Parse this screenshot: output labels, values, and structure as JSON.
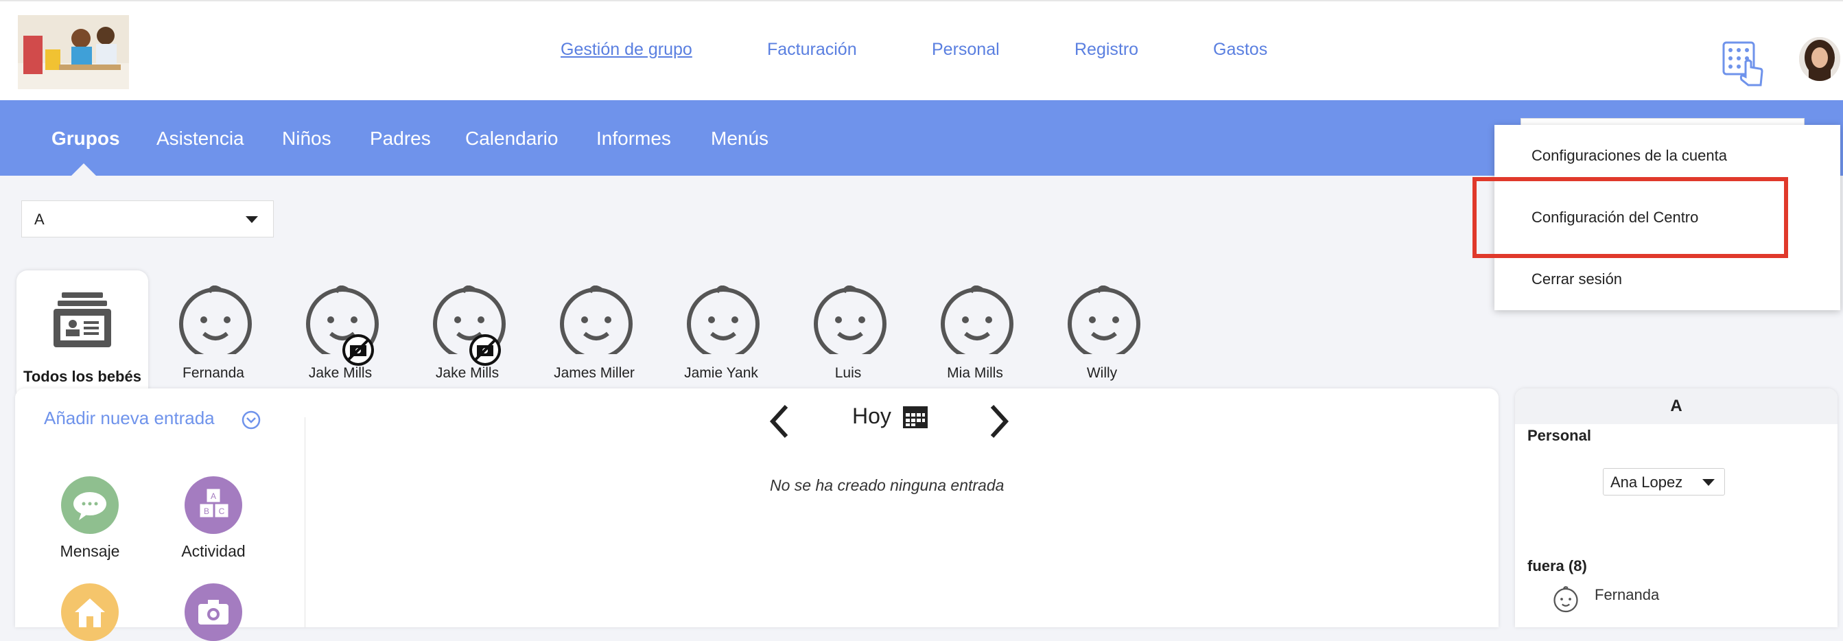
{
  "top_nav": {
    "items": [
      "Gestión de grupo",
      "Facturación",
      "Personal",
      "Registro",
      "Gastos"
    ],
    "active": "Gestión de grupo",
    "link_color": "#5a7fe0"
  },
  "main_tabs": {
    "items": [
      "Grupos",
      "Asistencia",
      "Niños",
      "Padres",
      "Calendario",
      "Informes",
      "Menús"
    ],
    "active": "Grupos",
    "bar_color": "#6f93eb"
  },
  "group_selector": {
    "value": "A"
  },
  "children": {
    "all_label": "Todos los bebés",
    "list": [
      {
        "name": "Fernanda",
        "no_photo_permission": false
      },
      {
        "name": "Jake Mills",
        "no_photo_permission": true
      },
      {
        "name": "Jake Mills",
        "no_photo_permission": true
      },
      {
        "name": "James Miller",
        "no_photo_permission": false
      },
      {
        "name": "Jamie Yank",
        "no_photo_permission": false
      },
      {
        "name": "Luis",
        "no_photo_permission": false
      },
      {
        "name": "Mia Mills",
        "no_photo_permission": false
      },
      {
        "name": "Willy",
        "no_photo_permission": false
      }
    ]
  },
  "entries_panel": {
    "add_new_label": "Añadir nueva entrada",
    "actions": [
      {
        "label": "Mensaje",
        "icon": "message-icon",
        "color": "#8fbf8f"
      },
      {
        "label": "Actividad",
        "icon": "blocks-icon",
        "color": "#a47cc0"
      },
      {
        "label": "",
        "icon": "home-icon",
        "color": "#f5c56b"
      },
      {
        "label": "",
        "icon": "camera-icon",
        "color": "#a47cc0"
      }
    ],
    "date_label": "Hoy",
    "empty_text": "No se ha creado ninguna entrada"
  },
  "side_panel": {
    "title": "A",
    "staff_label": "Personal",
    "staff_selected": "Ana Lopez",
    "out_label": "fuera (8)",
    "out_children": [
      "Fernanda"
    ]
  },
  "account_menu": {
    "items": [
      "Configuraciones de la cuenta",
      "Configuración del Centro",
      "Cerrar sesión"
    ],
    "highlighted": "Configuración del Centro",
    "highlight_color": "#e0392b"
  }
}
